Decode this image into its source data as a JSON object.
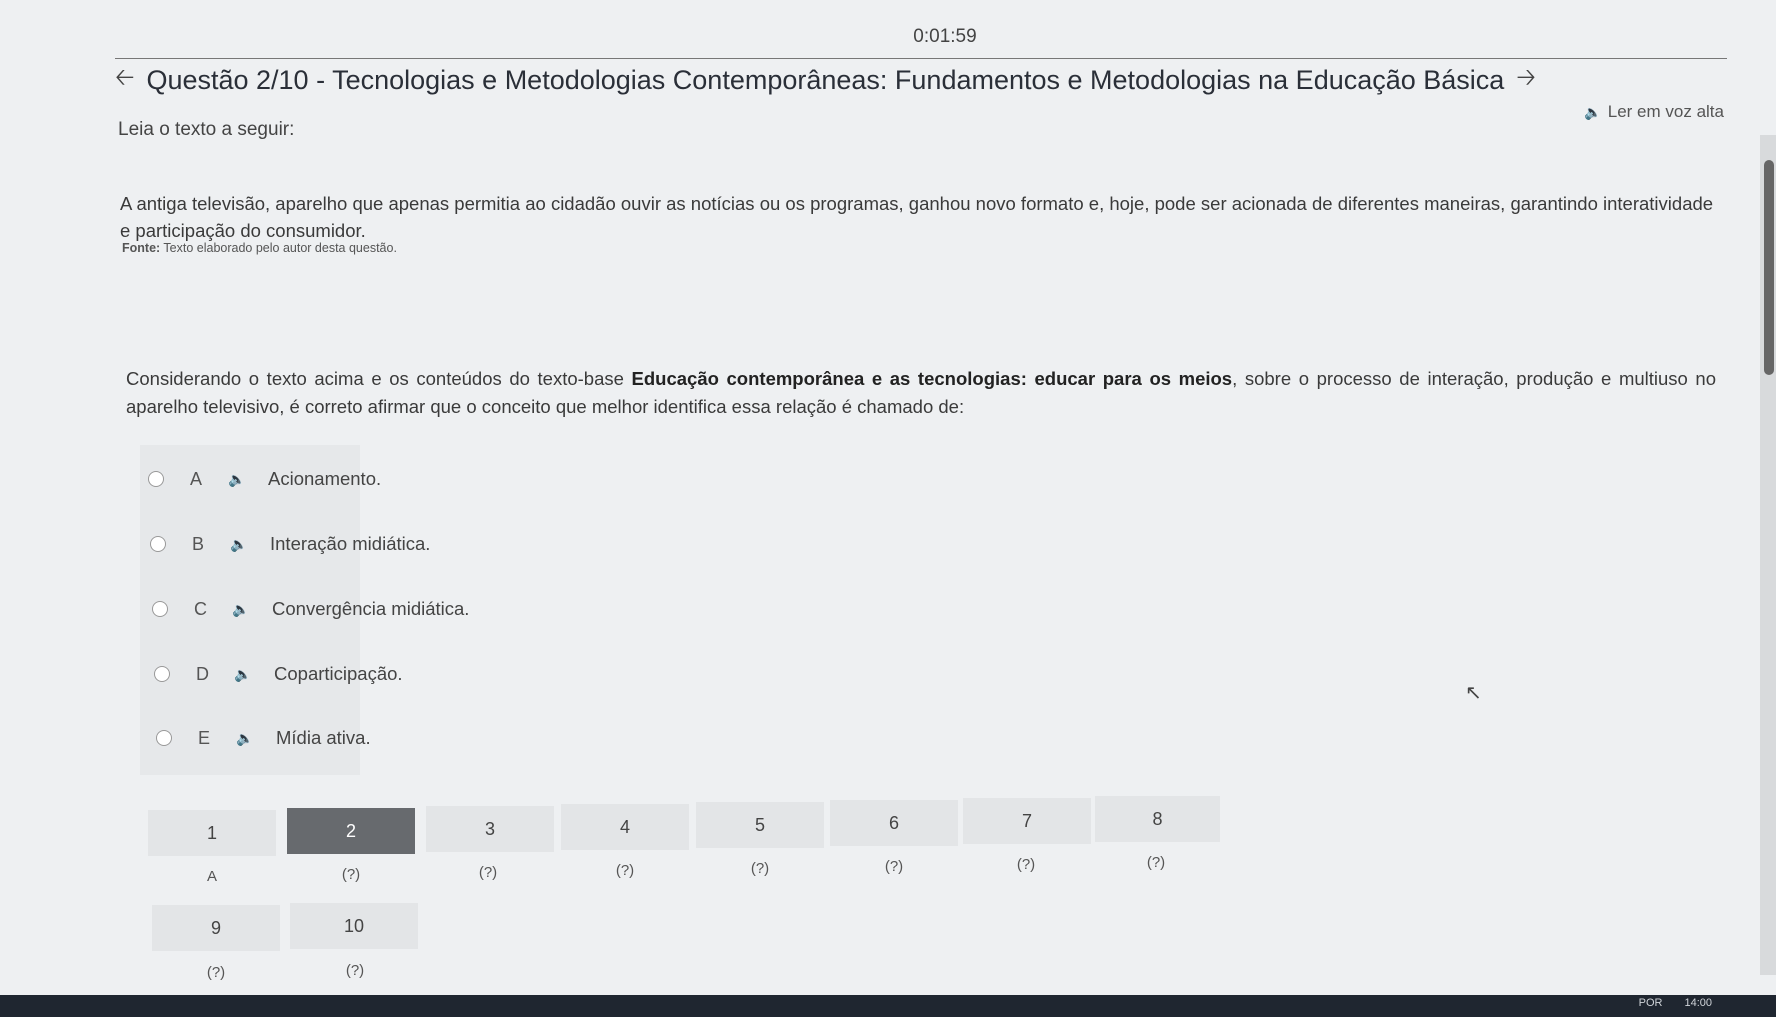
{
  "timer": "0:01:59",
  "header": {
    "title": "Questão 2/10 - Tecnologias e Metodologias Contemporâneas: Fundamentos e Metodologias na Educação Básica",
    "prev_icon": "arrow-left-icon",
    "next_icon": "arrow-right-icon"
  },
  "tts": {
    "label": "Ler em voz alta",
    "icon": "speaker-icon"
  },
  "lead": "Leia o texto a seguir:",
  "passage": "A antiga televisão, aparelho que apenas permitia ao cidadão ouvir as notícias ou os programas, ganhou novo formato e, hoje, pode ser acionada de diferentes maneiras, garantindo interatividade e participação do consumidor.",
  "source": {
    "label": "Fonte:",
    "text": " Texto elaborado pelo autor desta questão."
  },
  "question": {
    "part1": "Considerando o texto acima e os conteúdos do texto-base ",
    "bold": "Educação contemporânea e as tecnologias: educar para os meios",
    "part2": ", sobre o processo de interação, produção e multiuso no aparelho televisivo, é correto afirmar que o conceito que melhor identifica essa relação é chamado de:"
  },
  "options": [
    {
      "letter": "A",
      "text": "Acionamento."
    },
    {
      "letter": "B",
      "text": "Interação midiática."
    },
    {
      "letter": "C",
      "text": "Convergência midiática."
    },
    {
      "letter": "D",
      "text": "Coparticipação."
    },
    {
      "letter": "E",
      "text": "Mídia ativa."
    }
  ],
  "nav": {
    "active": "2",
    "items": [
      {
        "num": "1",
        "answer": "A"
      },
      {
        "num": "2",
        "answer": "(?)"
      },
      {
        "num": "3",
        "answer": "(?)"
      },
      {
        "num": "4",
        "answer": "(?)"
      },
      {
        "num": "5",
        "answer": "(?)"
      },
      {
        "num": "6",
        "answer": "(?)"
      },
      {
        "num": "7",
        "answer": "(?)"
      },
      {
        "num": "8",
        "answer": "(?)"
      },
      {
        "num": "9",
        "answer": "(?)"
      },
      {
        "num": "10",
        "answer": "(?)"
      }
    ]
  },
  "taskbar": {
    "lang": "POR",
    "time": "14:00"
  }
}
